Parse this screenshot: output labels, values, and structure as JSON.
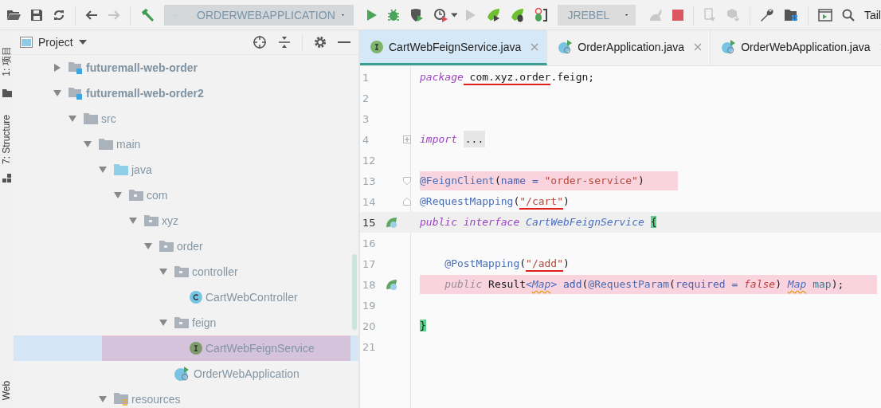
{
  "toolbar": {
    "run_configuration": "ORDERWEBAPPLICATION",
    "jrebel_configuration": "JREBEL",
    "tail_label": "Tail"
  },
  "side_tabs": [
    {
      "label": "1: 项目"
    },
    {
      "label": "7: Structure"
    },
    {
      "label": "Web"
    }
  ],
  "project_panel": {
    "title": "Project",
    "tree": [
      {
        "label": "futuremall-web-order",
        "kind": "module",
        "expanded": false,
        "selected": false
      },
      {
        "label": "futuremall-web-order2",
        "kind": "module",
        "expanded": true,
        "selected": false,
        "children": [
          {
            "label": "src",
            "kind": "folder",
            "expanded": true,
            "selected": false,
            "children": [
              {
                "label": "main",
                "kind": "folder",
                "expanded": true,
                "selected": false,
                "children": [
                  {
                    "label": "java",
                    "kind": "source",
                    "expanded": true,
                    "selected": false,
                    "children": [
                      {
                        "label": "com",
                        "kind": "package",
                        "expanded": true,
                        "selected": false,
                        "children": [
                          {
                            "label": "xyz",
                            "kind": "package",
                            "expanded": true,
                            "selected": false,
                            "children": [
                              {
                                "label": "order",
                                "kind": "package",
                                "expanded": true,
                                "selected": false,
                                "children": [
                                  {
                                    "label": "controller",
                                    "kind": "package",
                                    "expanded": true,
                                    "selected": false,
                                    "children": [
                                      {
                                        "label": "CartWebController",
                                        "kind": "class",
                                        "selected": false
                                      }
                                    ]
                                  },
                                  {
                                    "label": "feign",
                                    "kind": "package",
                                    "expanded": true,
                                    "selected": false,
                                    "children": [
                                      {
                                        "label": "CartWebFeignService",
                                        "kind": "interface",
                                        "selected": true,
                                        "highlighted": true
                                      }
                                    ]
                                  },
                                  {
                                    "label": "OrderWebApplication",
                                    "kind": "app",
                                    "selected": false
                                  }
                                ]
                              }
                            ]
                          }
                        ]
                      }
                    ]
                  },
                  {
                    "label": "resources",
                    "kind": "resources",
                    "expanded": true,
                    "selected": false
                  }
                ]
              }
            ]
          }
        ]
      }
    ]
  },
  "editor_tabs": [
    {
      "label": "CartWebFeignService.java",
      "kind": "interface",
      "selected": true
    },
    {
      "label": "OrderApplication.java",
      "kind": "app",
      "selected": false
    },
    {
      "label": "OrderWebApplication.java",
      "kind": "app",
      "selected": false
    }
  ],
  "code_lines": [
    {
      "number": "1",
      "tokens": [
        {
          "text": "package",
          "kind": "kw"
        },
        {
          "text": " com.xyz.order",
          "kind": "plain",
          "underlined": true
        },
        {
          "text": ".feign;",
          "kind": "plain"
        }
      ]
    },
    {
      "number": "2"
    },
    {
      "number": "3"
    },
    {
      "number": "4",
      "folded": true,
      "tokens": [
        {
          "text": "import ",
          "kind": "kw"
        },
        {
          "text": "...",
          "kind": "folded"
        }
      ]
    },
    {
      "number": "12"
    },
    {
      "number": "13",
      "fold_start": true,
      "highlighted": true,
      "tokens": [
        {
          "text": "@FeignClient",
          "kind": "ann"
        },
        {
          "text": "(",
          "kind": "plain"
        },
        {
          "text": "name = ",
          "kind": "param"
        },
        {
          "text": "\"order-service\"",
          "kind": "str"
        },
        {
          "text": ")",
          "kind": "plain"
        }
      ]
    },
    {
      "number": "14",
      "fold_end": true,
      "tokens": [
        {
          "text": "@RequestMapping",
          "kind": "ann"
        },
        {
          "text": "(",
          "kind": "plain"
        },
        {
          "text": "\"/cart\"",
          "kind": "str",
          "underlined": true
        },
        {
          "text": ")",
          "kind": "plain"
        }
      ]
    },
    {
      "number": "15",
      "current": true,
      "gutter_icon": true,
      "tokens": [
        {
          "text": "public",
          "kind": "kw"
        },
        {
          "text": " interface",
          "kind": "kw"
        },
        {
          "text": " CartWebFeignService ",
          "kind": "iface"
        },
        {
          "text": "{",
          "kind": "brace"
        }
      ]
    },
    {
      "number": "16"
    },
    {
      "number": "17",
      "tokens": [
        {
          "text": "    @PostMapping",
          "kind": "ann"
        },
        {
          "text": "(",
          "kind": "plain"
        },
        {
          "text": "\"/add\"",
          "kind": "str",
          "underlined": true
        },
        {
          "text": ")",
          "kind": "plain"
        }
      ]
    },
    {
      "number": "18",
      "highlighted": true,
      "gutter_icon": true,
      "tokens": [
        {
          "text": "    public",
          "kind": "kwdim"
        },
        {
          "text": " Result",
          "kind": "plain"
        },
        {
          "text": "<",
          "kind": "iface"
        },
        {
          "text": "Map",
          "kind": "iface",
          "warning": true
        },
        {
          "text": ">",
          "kind": "iface"
        },
        {
          "text": " add",
          "kind": "method"
        },
        {
          "text": "(",
          "kind": "plain"
        },
        {
          "text": "@RequestParam",
          "kind": "ann"
        },
        {
          "text": "(",
          "kind": "plain"
        },
        {
          "text": "required = ",
          "kind": "param"
        },
        {
          "text": "false",
          "kind": "kwred"
        },
        {
          "text": ") ",
          "kind": "plain"
        },
        {
          "text": "Map",
          "kind": "iface",
          "warning": true
        },
        {
          "text": " map",
          "kind": "local"
        },
        {
          "text": ");",
          "kind": "plain"
        }
      ]
    },
    {
      "number": "19"
    },
    {
      "number": "20",
      "tokens": [
        {
          "text": "}",
          "kind": "brace"
        }
      ]
    },
    {
      "number": "21"
    }
  ]
}
